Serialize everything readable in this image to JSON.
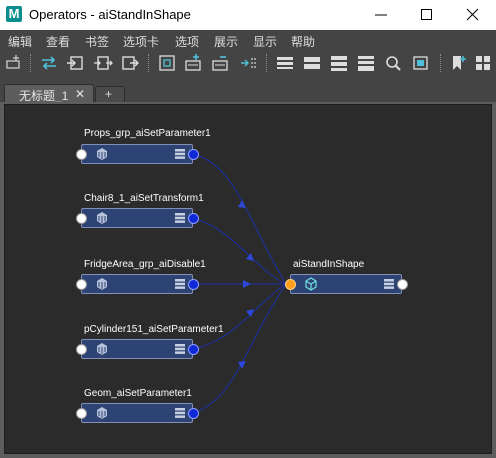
{
  "window": {
    "logo_letter": "M",
    "title": "Operators - aiStandInShape"
  },
  "menu": {
    "items": [
      "编辑",
      "查看",
      "书签",
      "选项卡",
      "选项",
      "展示",
      "显示",
      "帮助"
    ]
  },
  "toolbar": {
    "icons": [
      "add-node-icon",
      "swap-icon",
      "graph-input-icon",
      "graph-in-out-icon",
      "graph-output-icon",
      "frame-all-icon",
      "select-upstream-icon",
      "select-downstream-icon",
      "pin-icon",
      "layout-list-icon",
      "layout-compact-icon",
      "layout-expanded-icon",
      "layout-full-icon",
      "search-icon",
      "save-snapshot-icon",
      "bookmark-icon",
      "grid-icon"
    ]
  },
  "tabs": {
    "active_label": "无标题_1",
    "close_glyph": "✕",
    "add_glyph": "+"
  },
  "graph": {
    "colors": {
      "node_fill": "#2d4373",
      "node_border": "#8290b8",
      "port_out": "#1028d8",
      "port_in_active": "#ff9e1b",
      "wire": "#1a2fa8",
      "canvas": "#2b2b2b"
    },
    "operator_nodes": [
      {
        "label": "Props_grp_aiSetParameter1"
      },
      {
        "label": "Chair8_1_aiSetTransform1"
      },
      {
        "label": "FridgeArea_grp_aiDisable1"
      },
      {
        "label": "pCylinder151_aiSetParameter1"
      },
      {
        "label": "Geom_aiSetParameter1"
      }
    ],
    "target_node": {
      "label": "aiStandInShape"
    }
  }
}
